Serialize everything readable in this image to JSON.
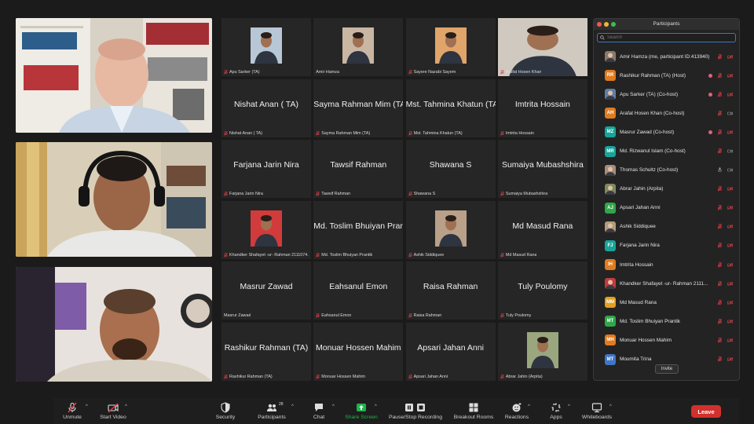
{
  "speakers": [
    {
      "id": "speaker-1"
    },
    {
      "id": "speaker-2"
    },
    {
      "id": "speaker-3"
    }
  ],
  "gallery": [
    {
      "type": "photo",
      "label": "Apu Sarker (TA)",
      "tone": "#b7c7d6"
    },
    {
      "type": "photo",
      "label": "Amir Hamza",
      "tone": "#c9b7a4",
      "nomic": true
    },
    {
      "type": "photo",
      "label": "Sayere Nazabi Sayem",
      "tone": "#e0a56a"
    },
    {
      "type": "video",
      "label": "Arafat Hosen Khan",
      "tone": "#cfc9bf"
    },
    {
      "type": "name",
      "name": "Nishat Anan ( TA)",
      "label": "Nishat Anan ( TA)"
    },
    {
      "type": "name",
      "name": "Sayma Rahman Mim (TA)",
      "label": "Sayma Rahman Mim (TA)"
    },
    {
      "type": "name",
      "name": "Mst. Tahmina Khatun (TA)",
      "label": "Mst. Tahmina Khatun (TA)"
    },
    {
      "type": "name",
      "name": "Imtrita Hossain",
      "label": "Imtrita Hossain"
    },
    {
      "type": "name",
      "name": "Farjana Jarin Nira",
      "label": "Farjana Jarin Nira"
    },
    {
      "type": "name",
      "name": "Tawsif Rahman",
      "label": "Tawsif Rahman"
    },
    {
      "type": "name",
      "name": "Shawana S",
      "label": "Shawana S"
    },
    {
      "type": "name",
      "name": "Sumaiya Mubashshira",
      "label": "Sumaiya Mubashshira"
    },
    {
      "type": "photo",
      "label": "Khandker Shafayet -ur- Rahman 2111074...",
      "tone": "#d23b3b"
    },
    {
      "type": "name",
      "name": "Md. Toslim Bhuiyan Prantik",
      "label": "Md. Toslim Bhuiyan Prantik"
    },
    {
      "type": "photo",
      "label": "Ashik Siddiquee",
      "tone": "#b8a089"
    },
    {
      "type": "name",
      "name": "Md Masud Rana",
      "label": "Md Masud Rana"
    },
    {
      "type": "name",
      "name": "Masrur Zawad",
      "label": "Masrur Zawad",
      "nomic": true
    },
    {
      "type": "name",
      "name": "Eahsanul Emon",
      "label": "Eahsanul Emon"
    },
    {
      "type": "name",
      "name": "Raisa Rahman",
      "label": "Raisa Rahman"
    },
    {
      "type": "name",
      "name": "Tuly Poulomy",
      "label": "Tuly Poulomy"
    },
    {
      "type": "name",
      "name": "Rashikur Rahman (TA)",
      "label": "Rashikur Rahman (TA)"
    },
    {
      "type": "name",
      "name": "Monuar Hossen Mahim",
      "label": "Monuar Hossen Mahim"
    },
    {
      "type": "name",
      "name": "Apsari Jahan Anni",
      "label": "Apsari Jahan Anni"
    },
    {
      "type": "photo",
      "label": "Abrar Jahin (Arpita)",
      "tone": "#9aa77e"
    }
  ],
  "panel": {
    "title": "Participants",
    "search_placeholder": "Search",
    "invite_label": "Invite",
    "participants": [
      {
        "name": "Amir Hamza (me, participant ID:413940)",
        "avatar": "photo",
        "color": "#8a7a6a",
        "video": "off"
      },
      {
        "name": "Rashikur Rahman (TA) (Host)",
        "initials": "RR",
        "color": "#e07b1f",
        "rec": true,
        "video": "off"
      },
      {
        "name": "Apu Sarker (TA) (Co-host)",
        "avatar": "photo",
        "color": "#5f7fa6",
        "rec": true,
        "video": "off"
      },
      {
        "name": "Arafat Hosen Khan (Co-host)",
        "initials": "AH",
        "color": "#e07b1f",
        "video": "on"
      },
      {
        "name": "Masrur Zawad (Co-host)",
        "initials": "MZ",
        "color": "#17a59a",
        "rec": true,
        "video": "off"
      },
      {
        "name": "Md. Rizwanul Islam (Co-host)",
        "initials": "MR",
        "color": "#17a59a",
        "video": "on"
      },
      {
        "name": "Thomas Schultz (Co-host)",
        "avatar": "photo",
        "color": "#a58e7a",
        "micon": true,
        "video": "on"
      },
      {
        "name": "Abrar Jahin (Arpita)",
        "avatar": "photo",
        "color": "#7d8a5e",
        "video": "off"
      },
      {
        "name": "Apsari Jahan Anni",
        "initials": "AJ",
        "color": "#2fa74a",
        "video": "off"
      },
      {
        "name": "Ashik Siddiquee",
        "avatar": "photo",
        "color": "#b49a7c",
        "video": "off"
      },
      {
        "name": "Farjana Jarin Nira",
        "initials": "FJ",
        "color": "#17a59a",
        "video": "off"
      },
      {
        "name": "Imtrita Hossain",
        "initials": "IH",
        "color": "#e07b1f",
        "video": "off"
      },
      {
        "name": "Khandker Shafayet -ur- Rahman 2111...",
        "avatar": "photo",
        "color": "#c23b3b",
        "video": "off"
      },
      {
        "name": "Md Masud Rana",
        "initials": "MM",
        "color": "#e0a01f",
        "video": "off"
      },
      {
        "name": "Md. Toslim Bhuiyan Prantik",
        "initials": "MT",
        "color": "#2fa74a",
        "video": "off"
      },
      {
        "name": "Monuar Hossen Mahim",
        "initials": "MH",
        "color": "#e07b1f",
        "video": "off"
      },
      {
        "name": "Moumita Trina",
        "initials": "MT",
        "color": "#3f76c5",
        "video": "off"
      }
    ]
  },
  "toolbar": {
    "unmute": "Unmute",
    "start_video": "Start Video",
    "security": "Security",
    "participants": "Participants",
    "participants_count": "28",
    "chat": "Chat",
    "share_screen": "Share Screen",
    "record": "Pause/Stop Recording",
    "breakout": "Breakout Rooms",
    "reactions": "Reactions",
    "apps": "Apps",
    "whiteboards": "Whiteboards",
    "leave": "Leave"
  },
  "colors": {
    "share_green": "#1fb34a",
    "leave_red": "#d0312d",
    "mic_off_red": "#e0404a"
  }
}
